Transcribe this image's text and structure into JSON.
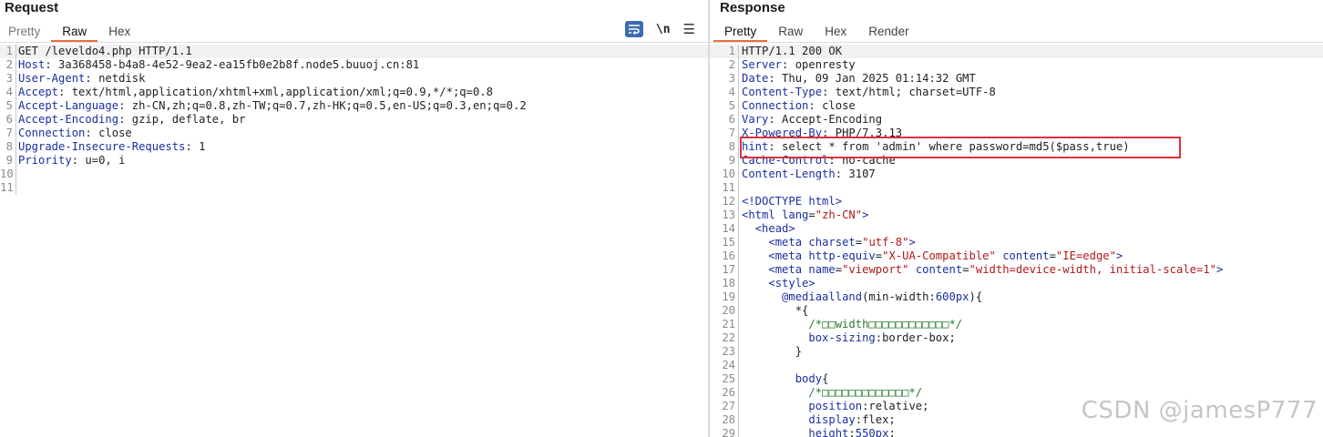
{
  "request": {
    "title": "Request",
    "tabs": [
      "Pretty",
      "Raw",
      "Hex"
    ],
    "active_tab": "Raw",
    "icons": [
      "wrap-icon",
      "newline-toggle",
      "menu-icon"
    ],
    "newline_label": "\\n",
    "lines": [
      {
        "n": "1",
        "k": "",
        "v": "GET /leveldo4.php HTTP/1.1"
      },
      {
        "n": "2",
        "k": "Host",
        "v": "3a368458-b4a8-4e52-9ea2-ea15fb0e2b8f.node5.buuoj.cn:81"
      },
      {
        "n": "3",
        "k": "User-Agent",
        "v": "netdisk"
      },
      {
        "n": "4",
        "k": "Accept",
        "v": "text/html,application/xhtml+xml,application/xml;q=0.9,*/*;q=0.8"
      },
      {
        "n": "5",
        "k": "Accept-Language",
        "v": "zh-CN,zh;q=0.8,zh-TW;q=0.7,zh-HK;q=0.5,en-US;q=0.3,en;q=0.2"
      },
      {
        "n": "6",
        "k": "Accept-Encoding",
        "v": "gzip, deflate, br"
      },
      {
        "n": "7",
        "k": "Connection",
        "v": "close"
      },
      {
        "n": "8",
        "k": "Upgrade-Insecure-Requests",
        "v": "1"
      },
      {
        "n": "9",
        "k": "Priority",
        "v": "u=0, i"
      },
      {
        "n": "10",
        "k": "",
        "v": ""
      },
      {
        "n": "11",
        "k": "",
        "v": ""
      }
    ]
  },
  "response": {
    "title": "Response",
    "tabs": [
      "Pretty",
      "Raw",
      "Hex",
      "Render"
    ],
    "active_tab": "Pretty",
    "lines": [
      {
        "n": "1",
        "type": "plain",
        "text": "HTTP/1.1 200 OK"
      },
      {
        "n": "2",
        "type": "header",
        "k": "Server",
        "v": "openresty"
      },
      {
        "n": "3",
        "type": "header",
        "k": "Date",
        "v": "Thu, 09 Jan 2025 01:14:32 GMT"
      },
      {
        "n": "4",
        "type": "header",
        "k": "Content-Type",
        "v": "text/html; charset=UTF-8"
      },
      {
        "n": "5",
        "type": "header",
        "k": "Connection",
        "v": "close"
      },
      {
        "n": "6",
        "type": "header",
        "k": "Vary",
        "v": "Accept-Encoding"
      },
      {
        "n": "7",
        "type": "header",
        "k": "X-Powered-By",
        "v": "PHP/7.3.13"
      },
      {
        "n": "8",
        "type": "header",
        "k": "hint",
        "v": "select * from 'admin' where password=md5($pass,true)"
      },
      {
        "n": "9",
        "type": "header",
        "k": "Cache-Control",
        "v": "no-cache"
      },
      {
        "n": "10",
        "type": "header",
        "k": "Content-Length",
        "v": "3107"
      },
      {
        "n": "11",
        "type": "plain",
        "text": ""
      },
      {
        "n": "12",
        "type": "tag",
        "text": "<!DOCTYPE html>"
      },
      {
        "n": "13",
        "type": "html",
        "indent": "",
        "parts": [
          [
            "tg",
            "<html "
          ],
          [
            "at",
            "lang"
          ],
          [
            "v",
            "="
          ],
          [
            "av",
            "\"zh-CN\""
          ],
          [
            "tg",
            ">"
          ]
        ]
      },
      {
        "n": "14",
        "type": "html",
        "indent": "  ",
        "parts": [
          [
            "tg",
            "<head>"
          ]
        ]
      },
      {
        "n": "15",
        "type": "html",
        "indent": "    ",
        "parts": [
          [
            "tg",
            "<meta "
          ],
          [
            "at",
            "charset"
          ],
          [
            "v",
            "="
          ],
          [
            "av",
            "\"utf-8\""
          ],
          [
            "tg",
            ">"
          ]
        ]
      },
      {
        "n": "16",
        "type": "html",
        "indent": "    ",
        "parts": [
          [
            "tg",
            "<meta "
          ],
          [
            "at",
            "http-equiv"
          ],
          [
            "v",
            "="
          ],
          [
            "av",
            "\"X-UA-Compatible\""
          ],
          [
            "v",
            " "
          ],
          [
            "at",
            "content"
          ],
          [
            "v",
            "="
          ],
          [
            "av",
            "\"IE=edge\""
          ],
          [
            "tg",
            ">"
          ]
        ]
      },
      {
        "n": "17",
        "type": "html",
        "indent": "    ",
        "parts": [
          [
            "tg",
            "<meta "
          ],
          [
            "at",
            "name"
          ],
          [
            "v",
            "="
          ],
          [
            "av",
            "\"viewport\""
          ],
          [
            "v",
            " "
          ],
          [
            "at",
            "content"
          ],
          [
            "v",
            "="
          ],
          [
            "av",
            "\"width=device-width, initial-scale=1\""
          ],
          [
            "tg",
            ">"
          ]
        ]
      },
      {
        "n": "18",
        "type": "html",
        "indent": "    ",
        "parts": [
          [
            "tg",
            "<style>"
          ]
        ]
      },
      {
        "n": "19",
        "type": "html",
        "indent": "      ",
        "parts": [
          [
            "tg",
            "@mediaalland"
          ],
          [
            "v",
            "(min-width:"
          ],
          [
            "tg",
            "600px"
          ],
          [
            "v",
            "){"
          ]
        ]
      },
      {
        "n": "20",
        "type": "html",
        "indent": "        ",
        "parts": [
          [
            "v",
            "*{"
          ]
        ]
      },
      {
        "n": "21",
        "type": "html",
        "indent": "          ",
        "parts": [
          [
            "cm",
            "/*□□width□□□□□□□□□□□□*/"
          ]
        ]
      },
      {
        "n": "22",
        "type": "html",
        "indent": "          ",
        "parts": [
          [
            "at",
            "box-sizing"
          ],
          [
            "v",
            ":border-box;"
          ]
        ]
      },
      {
        "n": "23",
        "type": "html",
        "indent": "        ",
        "parts": [
          [
            "v",
            "}"
          ]
        ]
      },
      {
        "n": "24",
        "type": "html",
        "indent": "",
        "parts": []
      },
      {
        "n": "25",
        "type": "html",
        "indent": "        ",
        "parts": [
          [
            "tg",
            "body"
          ],
          [
            "v",
            "{"
          ]
        ]
      },
      {
        "n": "26",
        "type": "html",
        "indent": "          ",
        "parts": [
          [
            "cm",
            "/*□□□□□□□□□□□□□*/"
          ]
        ]
      },
      {
        "n": "27",
        "type": "html",
        "indent": "          ",
        "parts": [
          [
            "at",
            "position"
          ],
          [
            "v",
            ":relative;"
          ]
        ]
      },
      {
        "n": "28",
        "type": "html",
        "indent": "          ",
        "parts": [
          [
            "at",
            "display"
          ],
          [
            "v",
            ":flex;"
          ]
        ]
      },
      {
        "n": "29",
        "type": "html",
        "indent": "          ",
        "parts": [
          [
            "at",
            "height"
          ],
          [
            "v",
            ":"
          ],
          [
            "tg",
            "550px"
          ],
          [
            "v",
            ";"
          ]
        ]
      }
    ]
  },
  "watermark": "CSDN @jamesP777",
  "colors": {
    "accent": "#e8703a",
    "highlight_box": "#d8333a",
    "wrap_button": "#3d6bb0"
  }
}
